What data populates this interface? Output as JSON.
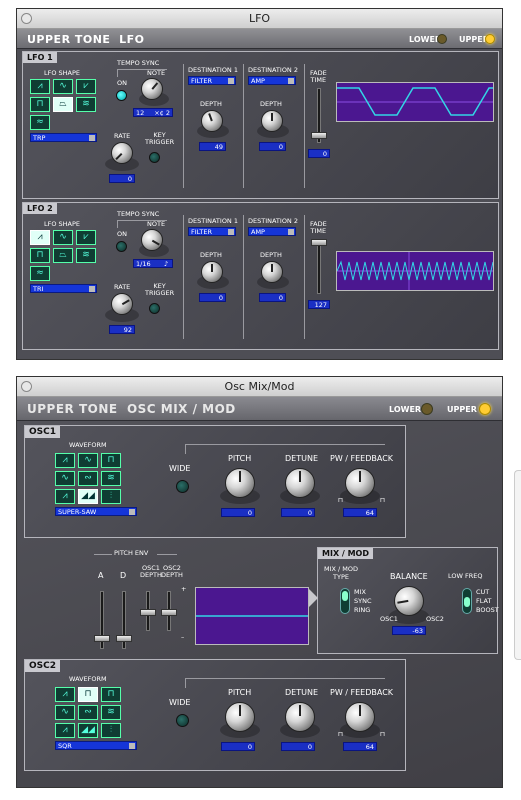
{
  "lfo_window": {
    "title": "LFO",
    "header_upper_tone": "UPPER  TONE",
    "header_section": "LFO",
    "lower_label": "LOWER",
    "upper_label": "UPPER",
    "lfo1": {
      "tag": "LFO 1",
      "lfo_shape_label": "LFO SHAPE",
      "shape_value": "TRP",
      "tempo_sync_label": "TEMPO SYNC",
      "on_label": "ON",
      "note_label": "NOTE",
      "note_value": "12",
      "note_suffix": "×¢ 2",
      "rate_label": "RATE",
      "rate_value": "0",
      "key_trigger_label": "KEY\nTRIGGER",
      "dest1_label": "DESTINATION 1",
      "dest1_value": "FILTER",
      "dest2_label": "DESTINATION 2",
      "dest2_value": "AMP",
      "depth1_label": "DEPTH",
      "depth1_value": "49",
      "depth2_label": "DEPTH",
      "depth2_value": "0",
      "fade_time_label": "FADE\nTIME",
      "fade_time_value": "0"
    },
    "lfo2": {
      "tag": "LFO 2",
      "lfo_shape_label": "LFO SHAPE",
      "shape_value": "TRI",
      "tempo_sync_label": "TEMPO SYNC",
      "on_label": "ON",
      "note_label": "NOTE",
      "note_value": "1/16",
      "note_suffix": "♪",
      "rate_label": "RATE",
      "rate_value": "92",
      "key_trigger_label": "KEY\nTRIGGER",
      "dest1_label": "DESTINATION 1",
      "dest1_value": "FILTER",
      "dest2_label": "DESTINATION 2",
      "dest2_value": "AMP",
      "depth1_label": "DEPTH",
      "depth1_value": "0",
      "depth2_label": "DEPTH",
      "depth2_value": "0",
      "fade_time_label": "FADE\nTIME",
      "fade_time_value": "127"
    }
  },
  "osc_window": {
    "title": "Osc Mix/Mod",
    "header_upper_tone": "UPPER  TONE",
    "header_section": "OSC MIX / MOD",
    "lower_label": "LOWER",
    "upper_label": "UPPER",
    "osc1": {
      "tag": "OSC1",
      "waveform_label": "WAVEFORM",
      "waveform_value": "SUPER-SAW",
      "wide_label": "WIDE",
      "pitch_label": "PITCH",
      "pitch_value": "0",
      "detune_label": "DETUNE",
      "detune_value": "0",
      "pw_label": "PW / FEEDBACK",
      "pw_value": "64"
    },
    "pitch_env": {
      "label": "PITCH ENV",
      "a_label": "A",
      "d_label": "D",
      "osc1_depth_label": "OSC1\nDEPTH",
      "osc2_depth_label": "OSC2\nDEPTH",
      "plus": "+",
      "minus": "–"
    },
    "mixmod": {
      "tag": "MIX / MOD",
      "type_label": "MIX / MOD\nTYPE",
      "type_options": [
        "MIX",
        "SYNC",
        "RING"
      ],
      "balance_label": "BALANCE",
      "osc1_label": "OSC1",
      "osc2_label": "OSC2",
      "balance_value": "-63",
      "low_freq_label": "LOW FREQ",
      "low_freq_options": [
        "CUT",
        "FLAT",
        "BOOST"
      ]
    },
    "osc2": {
      "tag": "OSC2",
      "waveform_label": "WAVEFORM",
      "waveform_value": "SQR",
      "wide_label": "WIDE",
      "pitch_label": "PITCH",
      "pitch_value": "0",
      "detune_label": "DETUNE",
      "detune_value": "0",
      "pw_label": "PW / FEEDBACK",
      "pw_value": "64"
    }
  },
  "colors": {
    "accent_blue": "#1535d8",
    "scope_purple": "#4b1790",
    "waveform_cyan": "#33d6e6",
    "led_on": "#ffcc33"
  }
}
